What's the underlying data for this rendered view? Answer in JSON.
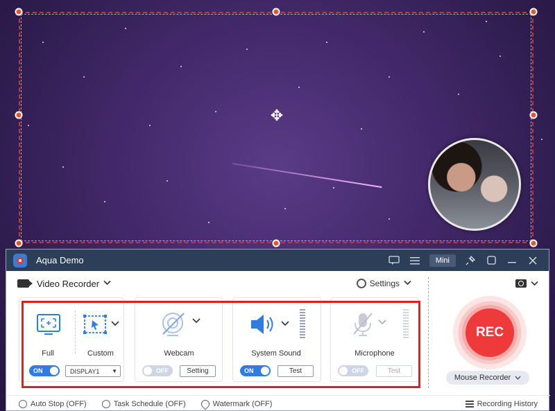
{
  "window": {
    "title": "Aqua Demo",
    "mini_label": "Mini"
  },
  "toolbar": {
    "mode_label": "Video Recorder",
    "settings_label": "Settings"
  },
  "display": {
    "full_label": "Full",
    "custom_label": "Custom",
    "toggle": "ON",
    "display_select": "DISPLAY1"
  },
  "webcam": {
    "label": "Webcam",
    "toggle": "OFF",
    "button": "Setting"
  },
  "system_sound": {
    "label": "System Sound",
    "toggle": "ON",
    "button": "Test"
  },
  "microphone": {
    "label": "Microphone",
    "toggle": "OFF",
    "button": "Test"
  },
  "record": {
    "rec_label": "REC",
    "mouse_recorder_label": "Mouse Recorder"
  },
  "footer": {
    "auto_stop": "Auto Stop (OFF)",
    "task_schedule": "Task Schedule (OFF)",
    "watermark": "Watermark (OFF)",
    "recording_history": "Recording History"
  },
  "colors": {
    "accent": "#2f7de1",
    "rec": "#ee3a3a",
    "titlebar": "#2c3e58",
    "highlight": "#e11d1d",
    "selection": "#c0392b"
  }
}
